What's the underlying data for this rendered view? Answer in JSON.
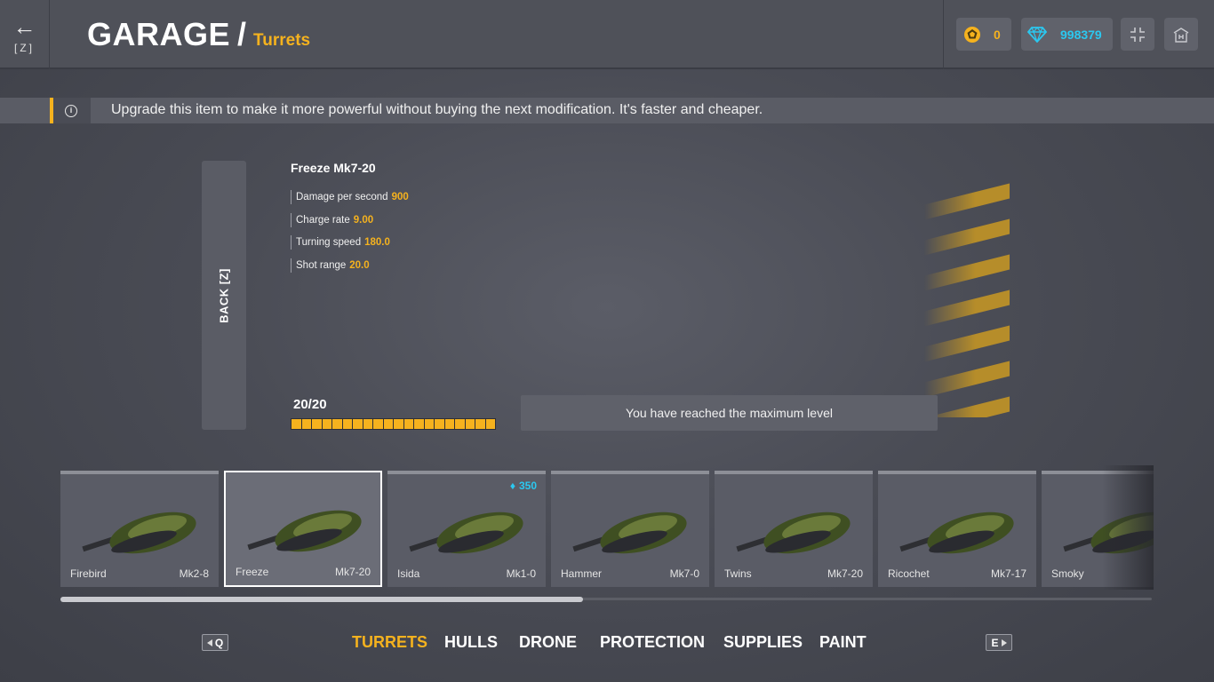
{
  "header": {
    "back_key": "[Z]",
    "title": "GARAGE",
    "separator": "/",
    "subtitle": "Turrets",
    "currency_small_value": "0",
    "crystals_value": "998379",
    "fullscreen_icon": "fullscreen-icon",
    "home_icon": "garage-home-icon"
  },
  "info": {
    "text": "Upgrade this item to make it more powerful without buying the next modification. It's faster and cheaper.",
    "icon": "info-icon"
  },
  "upgrade": {
    "back_label": "BACK [Z]",
    "item_name": "Freeze Mk7-20",
    "stats": [
      {
        "label": "Damage per second",
        "value": "900"
      },
      {
        "label": "Charge rate",
        "value": "9.00"
      },
      {
        "label": "Turning speed",
        "value": "180.0"
      },
      {
        "label": "Shot range",
        "value": "20.0"
      }
    ],
    "level_text": "20/20",
    "level_current": 20,
    "level_max": 20,
    "max_message": "You have reached the maximum level"
  },
  "turrets": [
    {
      "name": "Firebird",
      "mod": "Mk2-8",
      "price": "",
      "selected": false
    },
    {
      "name": "Freeze",
      "mod": "Mk7-20",
      "price": "",
      "selected": true
    },
    {
      "name": "Isida",
      "mod": "Mk1-0",
      "price": "350",
      "selected": false
    },
    {
      "name": "Hammer",
      "mod": "Mk7-0",
      "price": "",
      "selected": false
    },
    {
      "name": "Twins",
      "mod": "Mk7-20",
      "price": "",
      "selected": false
    },
    {
      "name": "Ricochet",
      "mod": "Mk7-17",
      "price": "",
      "selected": false
    },
    {
      "name": "Smoky",
      "mod": "",
      "price": "",
      "selected": false
    }
  ],
  "carousel_scroll_fraction": 0.479,
  "tabs": {
    "prev_key": "Q",
    "next_key": "E",
    "items": [
      "TURRETS",
      "HULLS",
      "DRONE",
      "PROTECTION",
      "SUPPLIES",
      "PAINT"
    ],
    "active": "TURRETS"
  },
  "colors": {
    "accent_gold": "#f5b21e",
    "crystal_blue": "#2bc8f0",
    "turret_green": "#3f4f22"
  }
}
